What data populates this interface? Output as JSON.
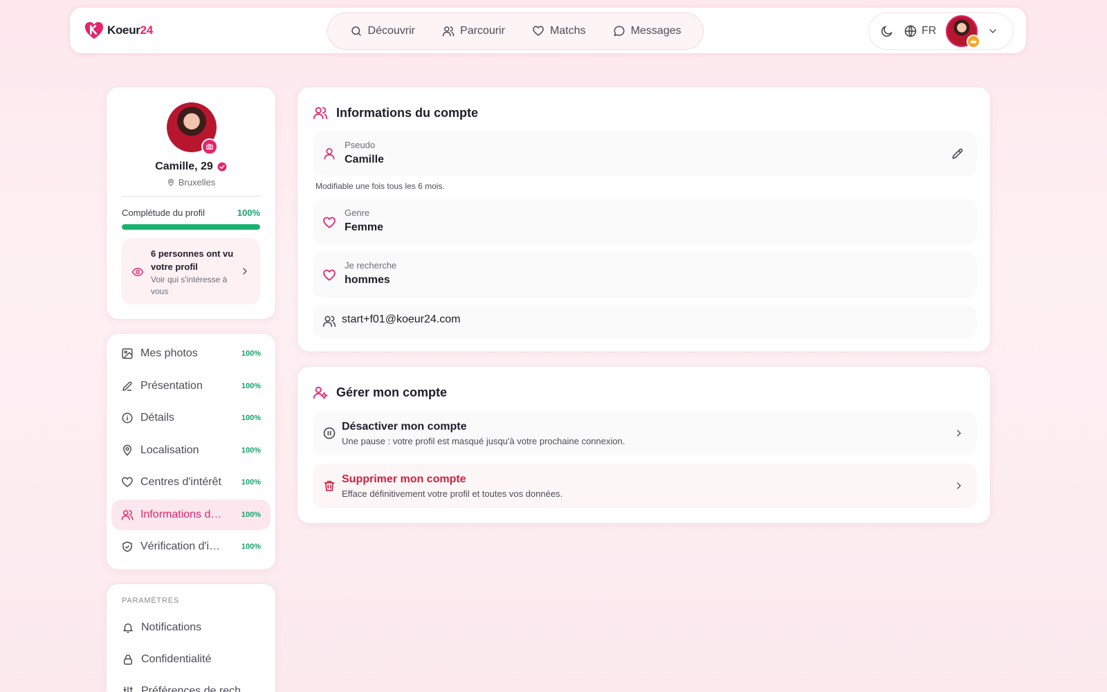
{
  "brand": {
    "name": "Koeur",
    "number": "24",
    "accent": "#e3256b"
  },
  "nav": {
    "items": [
      {
        "label": "Découvrir",
        "icon": "search-icon"
      },
      {
        "label": "Parcourir",
        "icon": "users-icon"
      },
      {
        "label": "Matchs",
        "icon": "heart-icon"
      },
      {
        "label": "Messages",
        "icon": "chat-bubble-icon"
      }
    ],
    "language": "FR"
  },
  "profile": {
    "name": "Camille, 29",
    "city": "Bruxelles",
    "completion_label": "Complétude du profil",
    "completion_value": "100%",
    "completion_fraction": 1.0,
    "views_title": "6 personnes ont vu votre profil",
    "views_sub": "Voir qui s'intéresse à vous"
  },
  "menu": {
    "items": [
      {
        "label": "Mes photos",
        "pct": "100%",
        "icon": "image-icon"
      },
      {
        "label": "Présentation",
        "pct": "100%",
        "icon": "pen-icon"
      },
      {
        "label": "Détails",
        "pct": "100%",
        "icon": "info-icon"
      },
      {
        "label": "Localisation",
        "pct": "100%",
        "icon": "location-pin-icon"
      },
      {
        "label": "Centres d'intérêt",
        "pct": "100%",
        "icon": "heart-icon"
      },
      {
        "label": "Informations du compte",
        "pct": "100%",
        "icon": "users-icon",
        "active": true
      },
      {
        "label": "Vérification d'identité",
        "pct": "100%",
        "icon": "shield-check-icon"
      }
    ]
  },
  "settings": {
    "header": "PARAMÈTRES",
    "items": [
      {
        "label": "Notifications",
        "icon": "bell-icon"
      },
      {
        "label": "Confidentialité",
        "icon": "lock-icon"
      },
      {
        "label": "Préférences de rech",
        "icon": "sliders-icon"
      }
    ]
  },
  "account": {
    "title": "Informations du compte",
    "pseudo_label": "Pseudo",
    "pseudo_value": "Camille",
    "pseudo_hint": "Modifiable une fois tous les 6 mois.",
    "genre_label": "Genre",
    "genre_value": "Femme",
    "search_label": "Je recherche",
    "search_value": "hommes",
    "email": "start+f01@koeur24.com"
  },
  "manage": {
    "title": "Gérer mon compte",
    "deactivate_title": "Désactiver mon compte",
    "deactivate_sub": "Une pause : votre profil est masqué jusqu'à votre prochaine connexion.",
    "delete_title": "Supprimer mon compte",
    "delete_sub": "Efface définitivement votre profil et toutes vos données."
  }
}
